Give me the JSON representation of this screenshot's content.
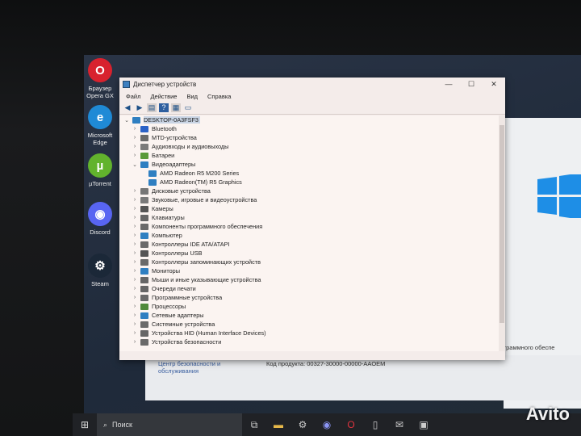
{
  "desktop_icons": [
    {
      "label": "Браузер Opera GX",
      "color": "#d8222e",
      "glyph": "O"
    },
    {
      "label": "Microsoft Edge",
      "color": "#1f8ad6",
      "glyph": "e"
    },
    {
      "label": "µTorrent",
      "color": "#62b32d",
      "glyph": "µ"
    },
    {
      "label": "Discord",
      "color": "#5865f2",
      "glyph": "◉"
    },
    {
      "label": "Steam",
      "color": "#1b2838",
      "glyph": "⚙"
    }
  ],
  "window": {
    "title": "Диспетчер устройств",
    "controls": [
      "—",
      "☐",
      "✕"
    ],
    "menu": [
      "Файл",
      "Действие",
      "Вид",
      "Справка"
    ],
    "toolbar_icons": [
      "back-arrow-icon",
      "forward-arrow-icon",
      "properties-icon",
      "help-icon",
      "update-driver-icon",
      "monitor-icon"
    ]
  },
  "tree": {
    "root": "DESKTOP-0A3FSF3",
    "nodes": [
      {
        "label": "Bluetooth",
        "expanded": false,
        "icon": "bluetooth-icon",
        "color": "#2b62c7"
      },
      {
        "label": "MTD-устройства",
        "expanded": false,
        "icon": "mtd-device-icon",
        "color": "#6b6b6b"
      },
      {
        "label": "Аудиовходы и аудиовыходы",
        "expanded": false,
        "icon": "speaker-icon",
        "color": "#7b7b7b"
      },
      {
        "label": "Батареи",
        "expanded": false,
        "icon": "battery-icon",
        "color": "#5a9a3a"
      },
      {
        "label": "Видеоадаптеры",
        "expanded": true,
        "icon": "display-adapter-icon",
        "color": "#2f7fc1",
        "children": [
          "AMD Radeon R5 M200 Series",
          "AMD Radeon(TM) R5 Graphics"
        ]
      },
      {
        "label": "Дисковые устройства",
        "expanded": false,
        "icon": "disk-icon",
        "color": "#777777"
      },
      {
        "label": "Звуковые, игровые и видеоустройства",
        "expanded": false,
        "icon": "sound-icon",
        "color": "#7a7a7a"
      },
      {
        "label": "Камеры",
        "expanded": false,
        "icon": "camera-icon",
        "color": "#555555"
      },
      {
        "label": "Клавиатуры",
        "expanded": false,
        "icon": "keyboard-icon",
        "color": "#666666"
      },
      {
        "label": "Компоненты программного обеспечения",
        "expanded": false,
        "icon": "software-component-icon",
        "color": "#6a6a6a"
      },
      {
        "label": "Компьютер",
        "expanded": false,
        "icon": "computer-icon",
        "color": "#2f7fc1"
      },
      {
        "label": "Контроллеры IDE ATA/ATAPI",
        "expanded": false,
        "icon": "ide-controller-icon",
        "color": "#6a6a6a"
      },
      {
        "label": "Контроллеры USB",
        "expanded": false,
        "icon": "usb-icon",
        "color": "#555555"
      },
      {
        "label": "Контроллеры запоминающих устройств",
        "expanded": false,
        "icon": "storage-controller-icon",
        "color": "#6a6a6a"
      },
      {
        "label": "Мониторы",
        "expanded": false,
        "icon": "monitor-icon",
        "color": "#2f7fc1"
      },
      {
        "label": "Мыши и иные указывающие устройства",
        "expanded": false,
        "icon": "mouse-icon",
        "color": "#666666"
      },
      {
        "label": "Очереди печати",
        "expanded": false,
        "icon": "print-queue-icon",
        "color": "#666666"
      },
      {
        "label": "Программные устройства",
        "expanded": false,
        "icon": "software-device-icon",
        "color": "#6a6a6a"
      },
      {
        "label": "Процессоры",
        "expanded": false,
        "icon": "processor-icon",
        "color": "#4f8a3a"
      },
      {
        "label": "Сетевые адаптеры",
        "expanded": false,
        "icon": "network-adapter-icon",
        "color": "#2f7fc1"
      },
      {
        "label": "Системные устройства",
        "expanded": false,
        "icon": "system-device-icon",
        "color": "#6a6a6a"
      },
      {
        "label": "Устройства HID (Human Interface Devices)",
        "expanded": false,
        "icon": "hid-icon",
        "color": "#666666"
      },
      {
        "label": "Устройства безопасности",
        "expanded": false,
        "icon": "security-device-icon",
        "color": "#6a6a6a"
      }
    ]
  },
  "background_window": {
    "security_center": "Центр безопасности и обслуживания",
    "product_code": "Код продукта: 00327-30000-00000-AAOEM",
    "software_text": "программного обеспе"
  },
  "taskbar": {
    "search_placeholder": "Поиск",
    "icons": [
      "task-view-icon",
      "file-explorer-icon",
      "steam-icon",
      "discord-icon",
      "opera-gx-icon",
      "documents-icon",
      "mail-icon",
      "device-manager-icon"
    ]
  },
  "watermark": "Avito"
}
